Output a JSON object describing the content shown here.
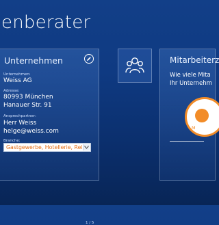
{
  "page": {
    "title": "enberater"
  },
  "company_card": {
    "heading": "Unternehmen",
    "company_label": "Unternehmen:",
    "company_value": "Weiss AG",
    "address_label": "Adresse:",
    "address_line1": "80993 München",
    "address_line2": "Hanauer Str. 91",
    "contact_label": "Ansprechpartner:",
    "contact_name": "Herr  Weiss",
    "contact_email": "helge@weiss.com",
    "industry_label": "Branche:",
    "industry_value": "Gastgewerbe, Hotellerie, Rei…",
    "pager": "1 / 5"
  },
  "staff_card": {
    "heading": "Mitarbeiterz",
    "question_line1": "Wie viele Mita",
    "question_line2": "Ihr Unternehm",
    "circle_label": "M"
  },
  "icons": {
    "edit": "pencil-icon",
    "users": "users-icon",
    "dropdown": "chevron-down-icon"
  },
  "colors": {
    "accent_orange": "#f28c28",
    "background": "#0f3a82"
  }
}
